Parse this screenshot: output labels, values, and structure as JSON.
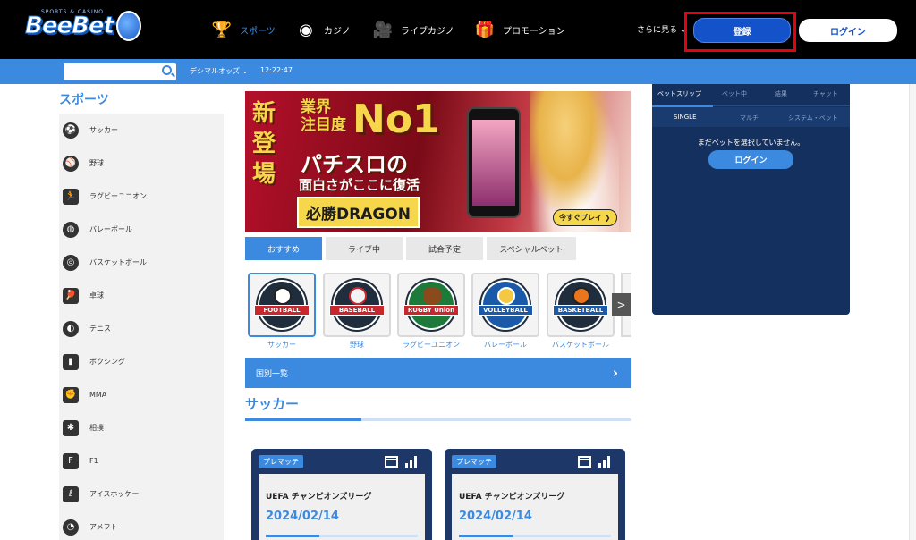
{
  "brand": {
    "name": "BeeBet",
    "tagline": "SPORTS & CASINO"
  },
  "nav": [
    {
      "label": "スポーツ",
      "icon": "trophy-icon",
      "glyph": "🏆",
      "active": true
    },
    {
      "label": "カジノ",
      "icon": "casino-chip-icon",
      "glyph": "◉",
      "active": false
    },
    {
      "label": "ライブカジノ",
      "icon": "live-casino-icon",
      "glyph": "🎥",
      "active": false
    },
    {
      "label": "プロモーション",
      "icon": "gift-icon",
      "glyph": "🎁",
      "active": false
    }
  ],
  "header": {
    "more_label": "さらに見る ⌄",
    "register_label": "登録",
    "login_label": "ログイン"
  },
  "subbar": {
    "search_placeholder": "",
    "odds_format": "デシマルオッズ ⌄",
    "time": "12:22:47"
  },
  "sidebar": {
    "title": "スポーツ",
    "items": [
      {
        "label": "サッカー",
        "icon": "soccer-ball-icon",
        "glyph": "⚽"
      },
      {
        "label": "野球",
        "icon": "baseball-icon",
        "glyph": "⚾"
      },
      {
        "label": "ラグビーユニオン",
        "icon": "rugby-player-icon",
        "glyph": "🏃"
      },
      {
        "label": "バレーボール",
        "icon": "volleyball-icon",
        "glyph": "◍"
      },
      {
        "label": "バスケットボール",
        "icon": "basketball-icon",
        "glyph": "◎"
      },
      {
        "label": "卓球",
        "icon": "table-tennis-icon",
        "glyph": "🏓"
      },
      {
        "label": "テニス",
        "icon": "tennis-ball-icon",
        "glyph": "◐"
      },
      {
        "label": "ボクシング",
        "icon": "punching-bag-icon",
        "glyph": "▮"
      },
      {
        "label": "MMA",
        "icon": "glove-icon",
        "glyph": "✊"
      },
      {
        "label": "相撲",
        "icon": "sumo-icon",
        "glyph": "✱"
      },
      {
        "label": "F1",
        "icon": "f1-icon",
        "glyph": "F"
      },
      {
        "label": "アイスホッケー",
        "icon": "hockey-stick-icon",
        "glyph": "ℓ"
      },
      {
        "label": "アメフト",
        "icon": "football-helmet-icon",
        "glyph": "◔"
      }
    ]
  },
  "banner": {
    "line_new": "新登場",
    "line_top": "業界\n注目度",
    "line_no1": "No1",
    "line_main": "パチスロの",
    "line_sub": "面白さがここに復活",
    "line_title": "必勝DRAGON",
    "cta": "今すぐプレイ ❯"
  },
  "tabs": [
    {
      "label": "おすすめ",
      "active": true
    },
    {
      "label": "ライブ中",
      "active": false
    },
    {
      "label": "試合予定",
      "active": false
    },
    {
      "label": "スペシャルベット",
      "active": false
    }
  ],
  "sport_cards": [
    {
      "label": "サッカー",
      "emblem": "FOOTBALL",
      "ball_color": "#ffffff",
      "selected": true
    },
    {
      "label": "野球",
      "emblem": "BASEBALL",
      "ball_color": "#f3f3f3",
      "selected": false
    },
    {
      "label": "ラグビーユニオン",
      "emblem": "RUGBY Union",
      "ball_color": "#8a4a1c",
      "selected": false
    },
    {
      "label": "バレーボール",
      "emblem": "VOLLEYBALL",
      "ball_color": "#f5c842",
      "selected": false
    },
    {
      "label": "バスケットボール",
      "emblem": "BASKETBALL",
      "ball_color": "#e8761f",
      "selected": false
    }
  ],
  "country_list": {
    "label": "国別一覧",
    "chevron": "›"
  },
  "section": {
    "title": "サッカー"
  },
  "matches": [
    {
      "badge": "プレマッチ",
      "league": "UEFA チャンピオンズリーグ",
      "date": "2024/02/14"
    },
    {
      "badge": "プレマッチ",
      "league": "UEFA チャンピオンズリーグ",
      "date": "2024/02/14"
    }
  ],
  "betslip": {
    "tabs": [
      "ベットスリップ",
      "ベット中",
      "結果",
      "チャット"
    ],
    "modes": [
      "SINGLE",
      "マルチ",
      "システム・ベット"
    ],
    "empty_text": "まだベットを選択していません。",
    "login_label": "ログイン"
  },
  "colors": {
    "accent": "#3c8ae0",
    "register": "#1352c9",
    "highlight": "#e60012",
    "slip_bg": "#14305e"
  }
}
